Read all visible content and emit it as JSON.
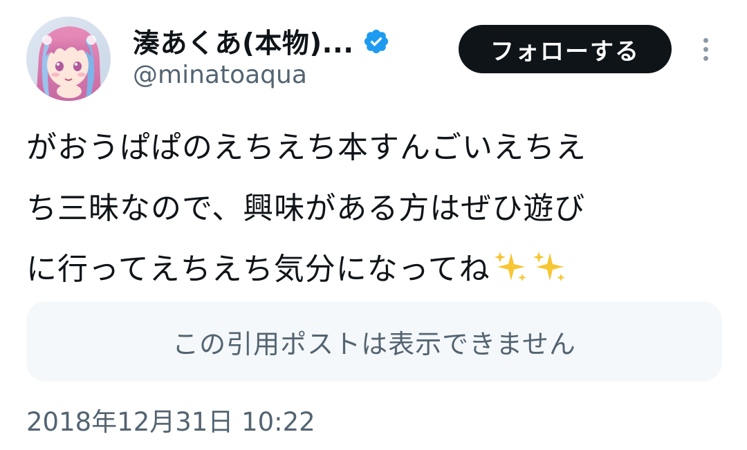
{
  "user": {
    "display_name": "湊あくあ(本物)...",
    "handle": "@minatoaqua",
    "verified_icon": "verified-badge-icon",
    "verified_color": "#1d9bf0"
  },
  "actions": {
    "follow_label": "フォローする",
    "more_icon": "more-vertical-icon"
  },
  "tweet": {
    "lines": [
      "がおうぱぱのえちえち本すんごいえちえ",
      "ち三昧なので、興味がある方はぜひ遊び",
      "に行ってえちえち気分になってね"
    ],
    "emoji": [
      "sparkles-icon",
      "sparkles-icon"
    ],
    "quote_unavailable": "この引用ポストは表示できません",
    "timestamp": "2018年12月31日 10:22"
  },
  "colors": {
    "text_primary": "#0f1419",
    "text_secondary": "#536471",
    "follow_bg": "#0f1419",
    "quote_bg": "#f5f8fa",
    "sparkle": "#f7c634"
  }
}
